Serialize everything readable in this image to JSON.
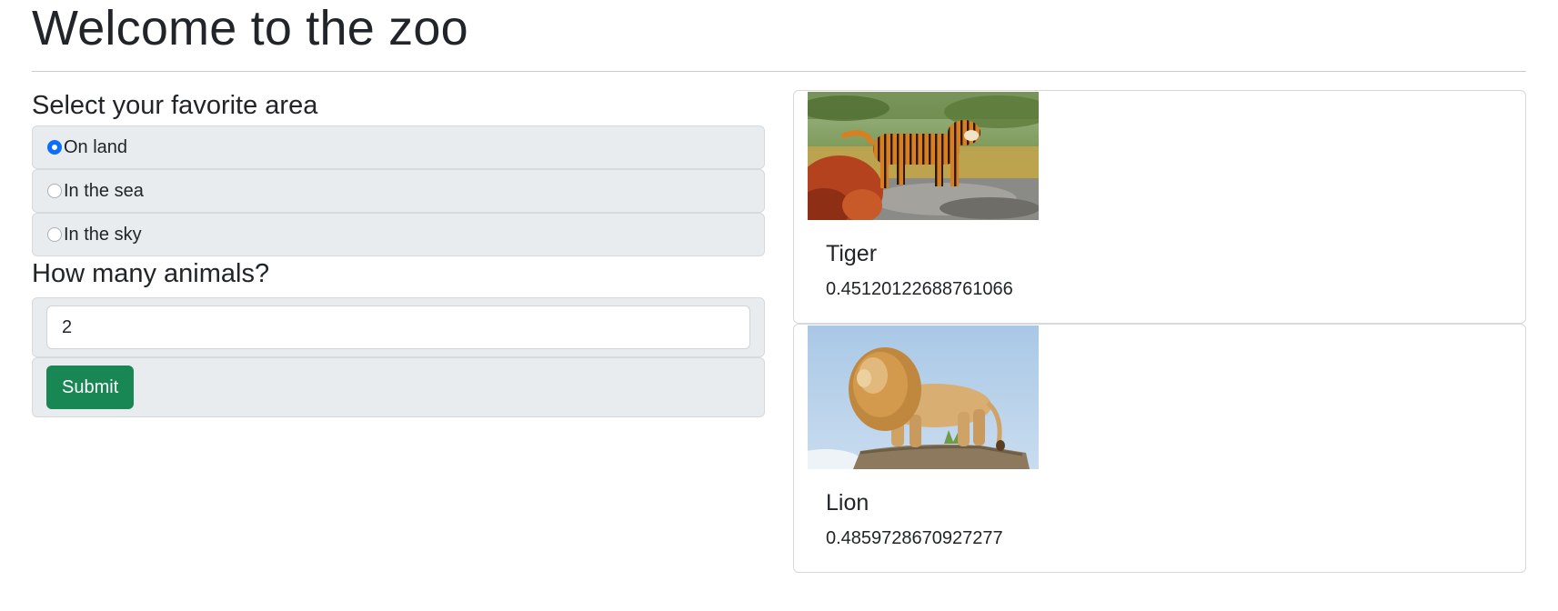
{
  "page": {
    "title": "Welcome to the zoo"
  },
  "form": {
    "area_heading": "Select your favorite area",
    "areas": [
      {
        "label": "On land",
        "checked": true
      },
      {
        "label": "In the sea",
        "checked": false
      },
      {
        "label": "In the sky",
        "checked": false
      }
    ],
    "count_heading": "How many animals?",
    "count_value": "2",
    "submit_label": "Submit",
    "submit_color": "#198754",
    "radio_accent": "#0d6efd"
  },
  "animals": [
    {
      "name": "Tiger",
      "value": "0.45120122688761066",
      "image": "tiger-photo"
    },
    {
      "name": "Lion",
      "value": "0.4859728670927277",
      "image": "lion-photo"
    }
  ]
}
